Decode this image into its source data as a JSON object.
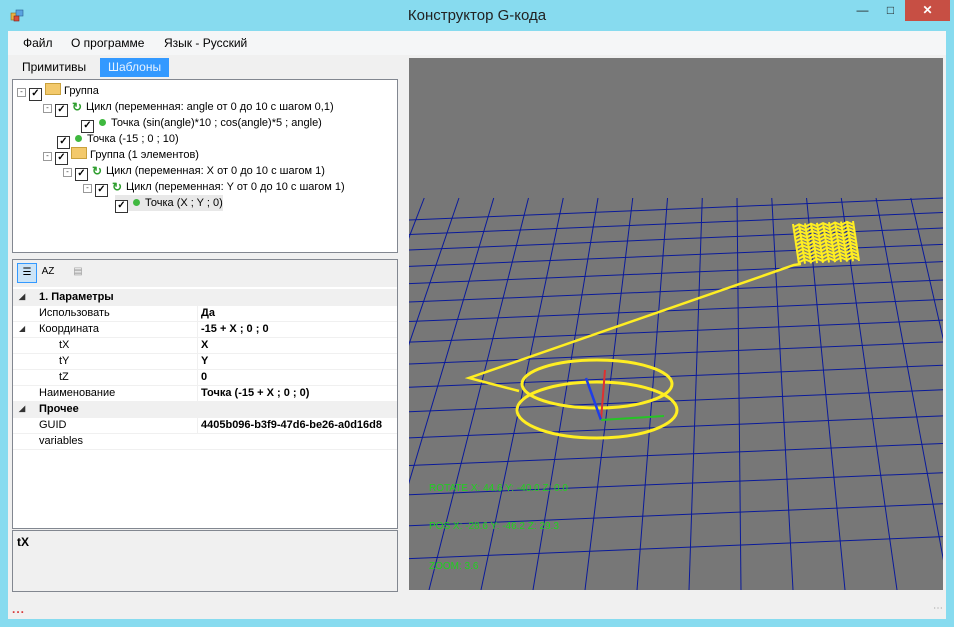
{
  "window": {
    "title": "Конструктор G-кода"
  },
  "menu": {
    "file": "Файл",
    "about": "О программе",
    "language": "Язык - Русский"
  },
  "tabs": {
    "primitives": "Примитивы",
    "templates": "Шаблоны"
  },
  "tree": [
    {
      "label": "Группа"
    },
    {
      "label": "Цикл (переменная: angle от 0 до 10 с шагом 0,1)"
    },
    {
      "label": "Точка (sin(angle)*10 ; cos(angle)*5 ; angle)"
    },
    {
      "label": "Точка (-15 ; 0 ; 10)"
    },
    {
      "label": "Группа (1 элементов)"
    },
    {
      "label": "Цикл (переменная: X от 0 до 10 с шагом 1)"
    },
    {
      "label": "Цикл (переменная: Y от 0 до 10 с шагом 1)"
    },
    {
      "label": "Точка (X ; Y ; 0)"
    }
  ],
  "properties": {
    "cat_params": "1. Параметры",
    "use_name": "Использовать",
    "use_value": "Да",
    "coord_name": "Координата",
    "coord_value": "-15 + X ; 0 ; 0",
    "tx_name": "tX",
    "tx_value": "X",
    "ty_name": "tY",
    "ty_value": "Y",
    "tz_name": "tZ",
    "tz_value": "0",
    "naming_name": "Наименование",
    "naming_value": "Точка (-15 + X ; 0 ; 0)",
    "cat_other": "Прочее",
    "guid_name": "GUID",
    "guid_value": "4405b096-b3f9-47d6-be26-a0d16d8",
    "variables_name": "variables",
    "variables_value": ""
  },
  "help": {
    "title": "tX"
  },
  "viewport": {
    "rotate_text": "ROTATE X: 44.6  Y: -40.0  Z: 0.0",
    "pos_text": "POS X: -28.6  Y: -46.2  Z: 29.3",
    "zoom_text": "ZOOM: 3.6",
    "background_color": "#777777",
    "grid_color": "#0a1a9a",
    "path_color": "#ffee22"
  },
  "status": {
    "text": "..."
  }
}
